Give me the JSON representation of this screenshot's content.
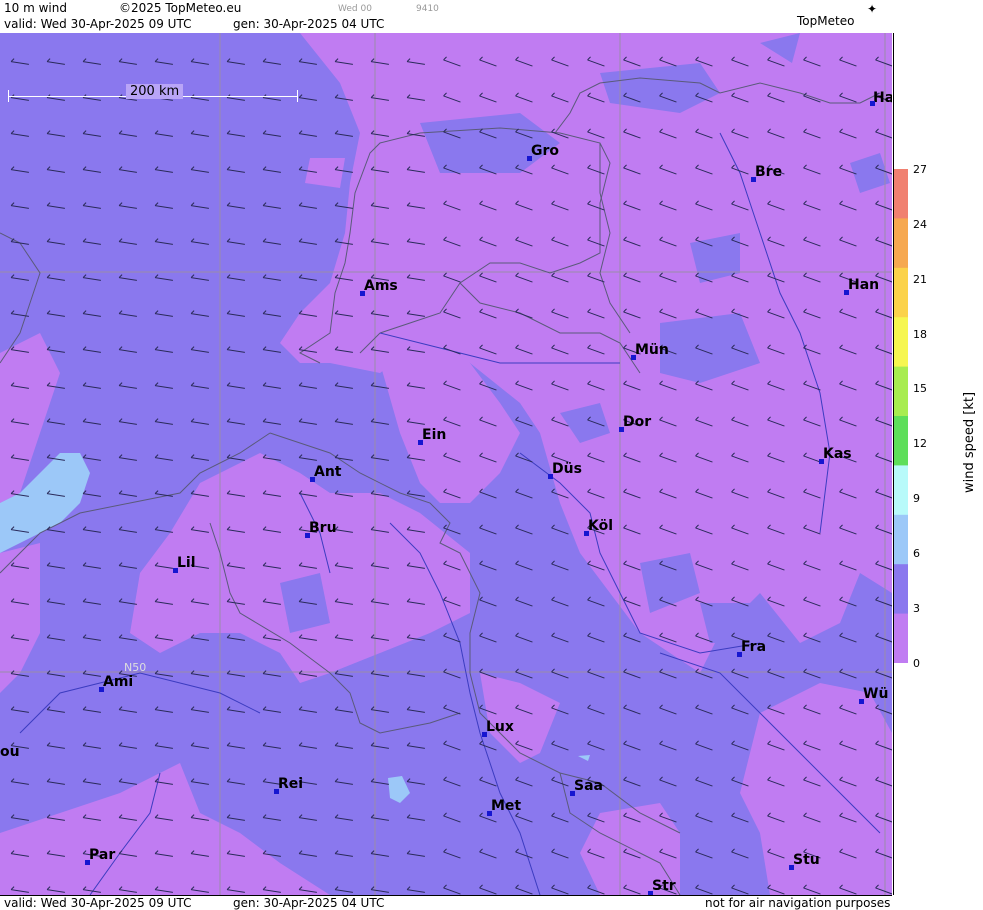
{
  "header": {
    "product": "10 m wind",
    "copyright": "©2025 TopMeteo.eu",
    "run_small": "Wed 00",
    "code_small": "9410",
    "valid": "valid:  Wed  30-Apr-2025  09 UTC",
    "gen": "gen: 30-Apr-2025 04 UTC",
    "brand": "TopMeteo"
  },
  "footer": {
    "valid": "valid:  Wed  30-Apr-2025  09 UTC",
    "gen": "gen: 30-Apr-2025 04 UTC",
    "disclaimer": "not for air navigation purposes"
  },
  "map": {
    "scale_label": "200 km",
    "grid_label": "N50",
    "cities": [
      {
        "name": "Ha"
      },
      {
        "name": "Gro"
      },
      {
        "name": "Bre"
      },
      {
        "name": "Ams"
      },
      {
        "name": "Han"
      },
      {
        "name": "Mün"
      },
      {
        "name": "Dor"
      },
      {
        "name": "Ein"
      },
      {
        "name": "Kas"
      },
      {
        "name": "Ant"
      },
      {
        "name": "Düs"
      },
      {
        "name": "Köl"
      },
      {
        "name": "Bru"
      },
      {
        "name": "Lil"
      },
      {
        "name": "Fra"
      },
      {
        "name": "Ami"
      },
      {
        "name": "Wü"
      },
      {
        "name": "Lux"
      },
      {
        "name": "ou"
      },
      {
        "name": "Rei"
      },
      {
        "name": "Saa"
      },
      {
        "name": "Met"
      },
      {
        "name": "Par"
      },
      {
        "name": "Stu"
      },
      {
        "name": "Str"
      }
    ]
  },
  "legend": {
    "unit": "wind  speed  [kt]",
    "ticks": [
      "27",
      "24",
      "21",
      "18",
      "15",
      "12",
      "9",
      "6",
      "3",
      "0"
    ],
    "colors": [
      "#f08070",
      "#f6a850",
      "#fbd24a",
      "#f6f650",
      "#a8ec50",
      "#5ede5a",
      "#b8fafa",
      "#9cc8f8",
      "#8a78ee",
      "#c07cf2"
    ]
  }
}
